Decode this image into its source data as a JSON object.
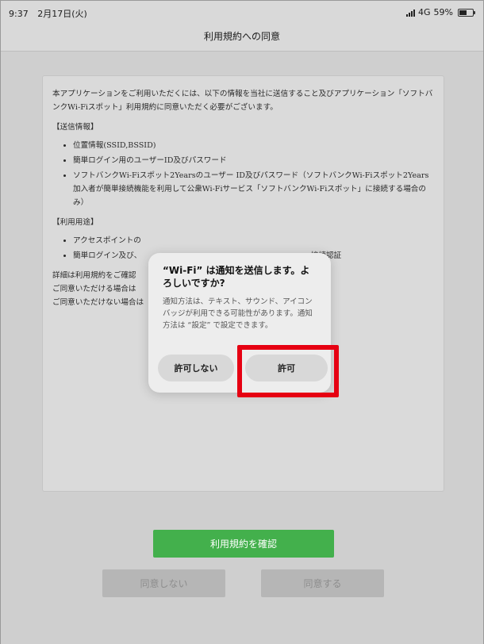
{
  "status": {
    "time": "9:37",
    "date": "2月17日(火)",
    "network": "4G",
    "battery": "59%",
    "battery_level": 0.59
  },
  "nav": {
    "title": "利用規約への同意"
  },
  "terms": {
    "intro": "本アプリケーションをご利用いただくには、以下の情報を当社に送信すること及びアプリケーション「ソフトバンクWi-Fiスポット」利用規約に同意いただく必要がございます。",
    "send_title": "【送信情報】",
    "send_items": [
      "位置情報(SSID,BSSID)",
      "簡単ログイン用のユーザーID及びパスワード",
      "ソフトバンクWi-Fiスポット2Yearsのユーザー ID及びパスワード（ソフトバンクWi-Fiスポット2Years加入者が簡単接続機能を利用して公衆Wi-Fiサービス「ソフトバンクWi-Fiスポット」に接続する場合のみ）"
    ],
    "purpose_title": "【利用用途】",
    "purpose_items": [
      "アクセスポイントの",
      "簡単ログイン及び、                                                                      接続認証"
    ],
    "details_lines": [
      "詳細は利用規約をご確認",
      "ご同意いただける場合は",
      "ご同意いただけない場合は"
    ]
  },
  "buttons": {
    "confirm": "利用規約を確認",
    "disagree": "同意しない",
    "agree": "同意する"
  },
  "dialog": {
    "title": "“Wi-Fi” は通知を送信します。よろしいですか?",
    "body": "通知方法は、テキスト、サウンド、アイコンバッジが利用できる可能性があります。通知方法は “設定” で設定できます。",
    "deny": "許可しない",
    "allow": "許可"
  },
  "colors": {
    "confirm_green": "#43b04c",
    "highlight_red": "#e60012"
  }
}
